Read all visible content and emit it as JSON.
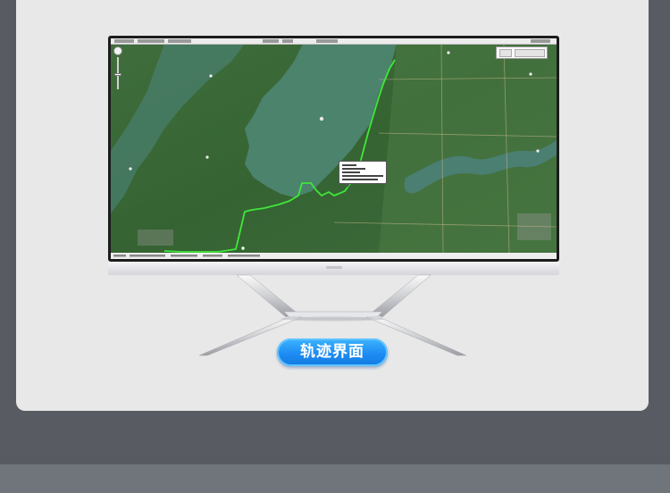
{
  "badge": {
    "label": "轨迹界面"
  },
  "colors": {
    "page_background": "#585c62",
    "panel_background": "#e8e8e8",
    "badge_blue": "#1e8cf3",
    "track_line": "#3fe83a",
    "map_land": "#3c6a3a",
    "map_water": "#4f8a72"
  },
  "icons": {
    "zoom": "zoom-slider-icon",
    "start_marker": "flag-icon",
    "map_pin": "map-pin-icon"
  }
}
